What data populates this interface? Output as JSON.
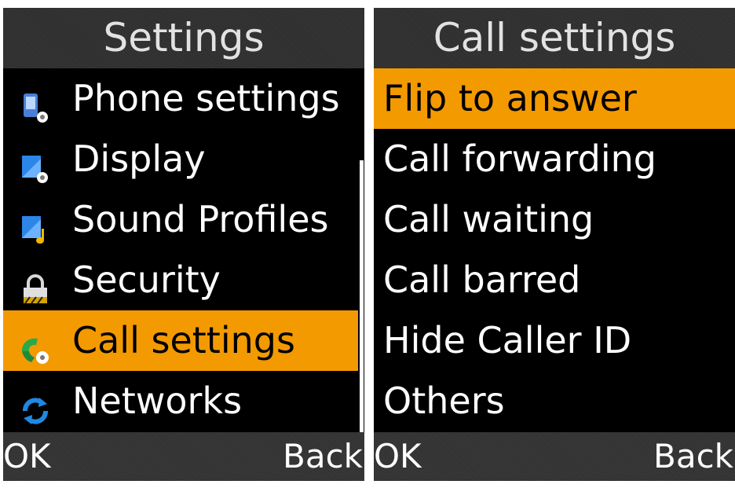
{
  "settings": {
    "title": "Settings",
    "items": [
      {
        "label": "Phone settings",
        "icon": "phone-settings-icon"
      },
      {
        "label": "Display",
        "icon": "display-settings-icon"
      },
      {
        "label": "Sound Profiles",
        "icon": "sound-profiles-icon"
      },
      {
        "label": "Security",
        "icon": "padlock-icon"
      },
      {
        "label": "Call settings",
        "icon": "call-settings-icon",
        "selected": true
      },
      {
        "label": "Networks",
        "icon": "networks-icon"
      }
    ],
    "softkey_left": "OK",
    "softkey_right": "Back"
  },
  "call_settings": {
    "title": "Call settings",
    "items": [
      {
        "label": "Flip to answer",
        "selected": true
      },
      {
        "label": "Call forwarding"
      },
      {
        "label": "Call waiting"
      },
      {
        "label": "Call barred"
      },
      {
        "label": "Hide Caller ID"
      },
      {
        "label": "Others"
      }
    ],
    "softkey_left": "OK",
    "softkey_right": "Back"
  },
  "colors": {
    "highlight": "#f39a00",
    "background": "#000000",
    "text": "#ffffff"
  }
}
